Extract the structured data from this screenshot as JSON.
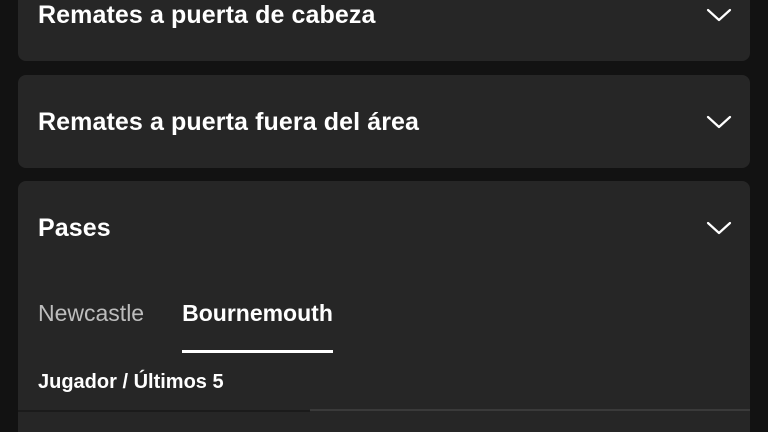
{
  "sections": [
    {
      "title": "Remates a puerta de cabeza",
      "chevron_icon": "chevron-down-icon"
    },
    {
      "title": "Remates a puerta fuera del área",
      "chevron_icon": "chevron-down-icon"
    },
    {
      "title": "Pases",
      "chevron_icon": "chevron-down-icon",
      "tabs": [
        {
          "label": "Newcastle",
          "active": false
        },
        {
          "label": "Bournemouth",
          "active": true
        }
      ],
      "table": {
        "header": "Jugador / Últimos 5",
        "first_row_partial": ""
      }
    }
  ],
  "colors": {
    "background": "#121212",
    "card": "#262626",
    "text": "#ffffff",
    "inactive_tab": "#bdbdbd"
  }
}
